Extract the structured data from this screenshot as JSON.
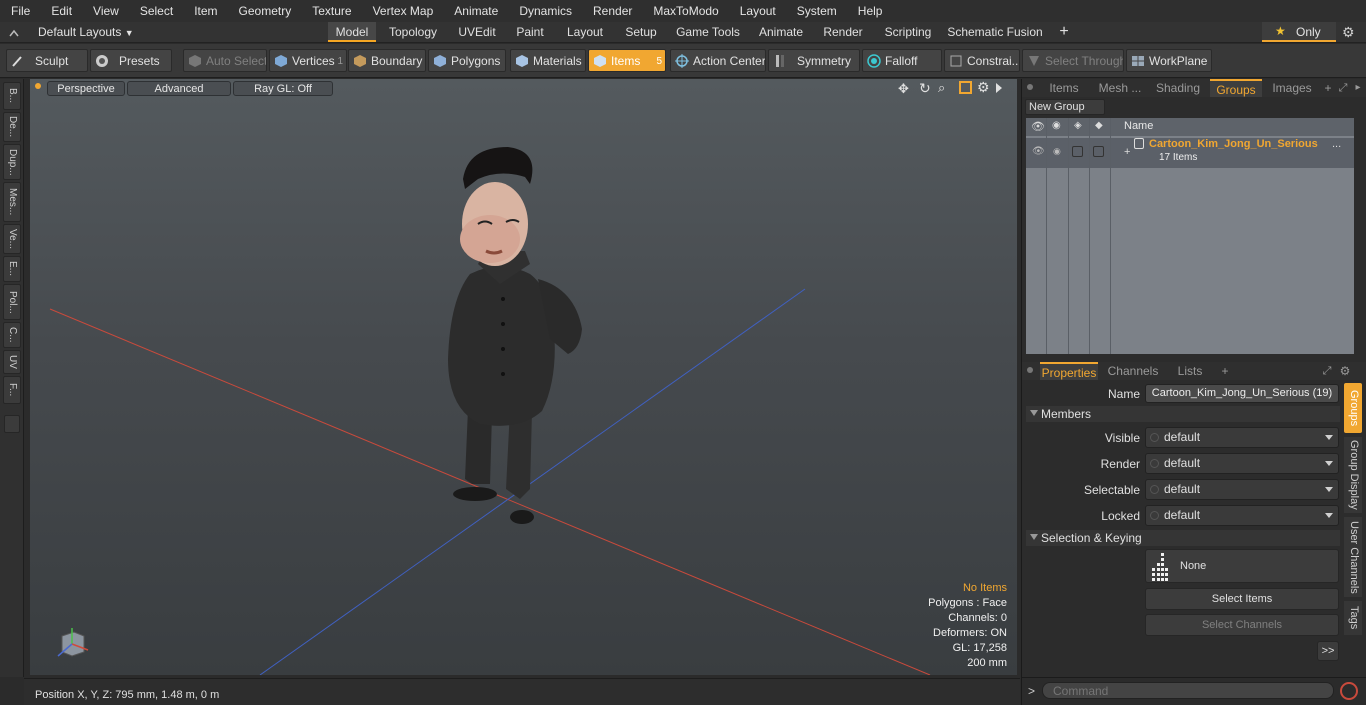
{
  "menu": [
    "File",
    "Edit",
    "View",
    "Select",
    "Item",
    "Geometry",
    "Texture",
    "Vertex Map",
    "Animate",
    "Dynamics",
    "Render",
    "MaxToModo",
    "Layout",
    "System",
    "Help"
  ],
  "layout": {
    "selector": "Default Layouts",
    "tabs": [
      "Model",
      "Topology",
      "UVEdit",
      "Paint",
      "Layout",
      "Setup",
      "Game Tools",
      "Animate",
      "Render",
      "Scripting",
      "Schematic Fusion"
    ],
    "only_label": "Only"
  },
  "toolbar": {
    "sculpt": "Sculpt",
    "presets": "Presets",
    "auto_select": "Auto Select",
    "vertices": "Vertices",
    "vertices_count": "1",
    "boundary": "Boundary",
    "polygons": "Polygons",
    "materials": "Materials",
    "items": "Items",
    "items_count": "5",
    "action_center": "Action Center",
    "symmetry": "Symmetry",
    "falloff": "Falloff",
    "constraints": "Constrai...",
    "select_through": "Select Through",
    "workplane": "WorkPlane"
  },
  "left_tabs": [
    "B...",
    "De...",
    "Dup...",
    "Mes...",
    "Ve...",
    "E...",
    "Pol...",
    "C...",
    "UV",
    "F..."
  ],
  "viewport": {
    "view": "Perspective",
    "shading": "Advanced",
    "raygl": "Ray GL: Off",
    "info": {
      "items": "No Items",
      "polygons": "Polygons : Face",
      "channels": "Channels: 0",
      "deformers": "Deformers: ON",
      "gl": "GL: 17,258",
      "scale": "200 mm"
    }
  },
  "status": {
    "position": "Position X, Y, Z:   795 mm, 1.48 m, 0 m"
  },
  "top_panel": {
    "tabs": [
      "Items",
      "Mesh ...",
      "Shading",
      "Groups",
      "Images"
    ],
    "active_tab": "Groups",
    "new_group": "New Group",
    "column_name": "Name",
    "group_name": "Cartoon_Kim_Jong_Un_Serious",
    "group_count": "17 Items"
  },
  "properties": {
    "tabs": [
      "Properties",
      "Channels",
      "Lists"
    ],
    "name_label": "Name",
    "name_value": "Cartoon_Kim_Jong_Un_Serious (19)",
    "members_header": "Members",
    "rows": [
      {
        "label": "Visible",
        "value": "default"
      },
      {
        "label": "Render",
        "value": "default"
      },
      {
        "label": "Selectable",
        "value": "default"
      },
      {
        "label": "Locked",
        "value": "default"
      }
    ],
    "selection_header": "Selection & Keying",
    "none_label": "None",
    "select_items": "Select Items",
    "select_channels": "Select Channels",
    "more": ">>",
    "side_tabs": [
      "Groups",
      "Group Display",
      "User Channels",
      "Tags"
    ],
    "command_placeholder": "Command"
  },
  "colors": {
    "accent": "#f1a731",
    "selected_group_text": "#f1a731",
    "axis_x": "#d04a3a",
    "axis_z": "#4560c8"
  }
}
